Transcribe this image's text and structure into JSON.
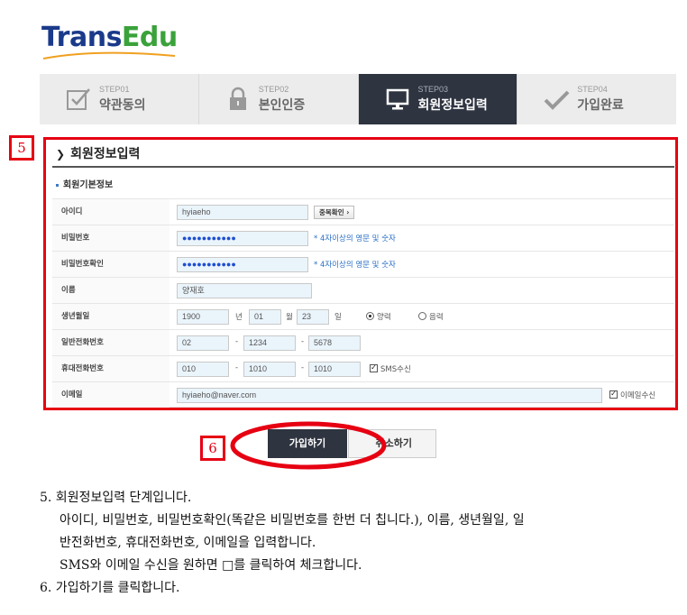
{
  "logo": {
    "part1": "Trans",
    "part2": "Edu"
  },
  "steps": [
    {
      "num": "STEP01",
      "label": "약관동의",
      "icon": "checkbox-icon"
    },
    {
      "num": "STEP02",
      "label": "본인인증",
      "icon": "lock-icon"
    },
    {
      "num": "STEP03",
      "label": "회원정보입력",
      "icon": "monitor-icon",
      "active": true
    },
    {
      "num": "STEP04",
      "label": "가입완료",
      "icon": "check-icon"
    }
  ],
  "annotations": {
    "badge5": "5",
    "badge6": "6"
  },
  "section": {
    "title": "회원정보입력",
    "subtitle": "회원기본정보"
  },
  "form": {
    "id": {
      "label": "아이디",
      "value": "hyiaeho",
      "button": "중복확인 ›"
    },
    "password": {
      "label": "비밀번호",
      "dots": "●●●●●●●●●●●",
      "hint": "* 4자이상의 영문 및 숫자"
    },
    "password_confirm": {
      "label": "비밀번호확인",
      "dots": "●●●●●●●●●●●",
      "hint": "* 4자이상의 영문 및 숫자"
    },
    "name": {
      "label": "이름",
      "value": "양재호"
    },
    "birth": {
      "label": "생년월일",
      "year": "1900",
      "year_unit": "년",
      "month": "01",
      "month_unit": "월",
      "day": "23",
      "day_unit": "일",
      "solar": "양력",
      "lunar": "음력"
    },
    "phone": {
      "label": "일반전화번호",
      "p1": "02",
      "p2": "1234",
      "p3": "5678",
      "dash": "-"
    },
    "mobile": {
      "label": "휴대전화번호",
      "p1": "010",
      "p2": "1010",
      "p3": "1010",
      "dash": "-",
      "sms": "SMS수신"
    },
    "email": {
      "label": "이메일",
      "value": "hyiaeho@naver.com",
      "receive": "이메일수신"
    }
  },
  "buttons": {
    "join": "가입하기",
    "cancel": "취소하기"
  },
  "instructions": {
    "l1": "5. 회원정보입력 단계입니다.",
    "l2": "아이디, 비밀번호, 비밀번호확인(똑같은 비밀번호를 한번 더 칩니다.), 이름, 생년월일, 일",
    "l3": "반전화번호, 휴대전화번호, 이메일을 입력합니다.",
    "l4": "SMS와 이메일 수신을 원하면 □를 클릭하여 체크합니다.",
    "l5": "6. 가입하기를 클릭합니다."
  },
  "colors": {
    "accent_red": "#e60012",
    "active_step": "#2e3440",
    "hint_blue": "#2a6fc4",
    "logo_blue": "#1a3a8a",
    "logo_green": "#3aa23a"
  }
}
